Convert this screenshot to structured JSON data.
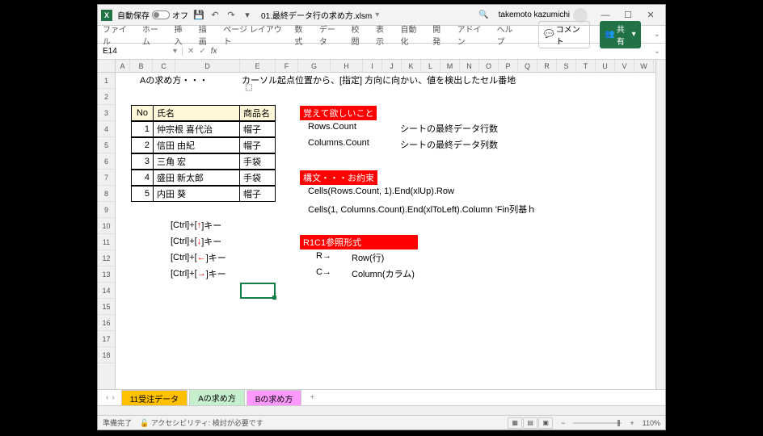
{
  "titlebar": {
    "autosave_label": "自動保存",
    "autosave_state": "オフ",
    "filename": "01.最終データ行の求め方.xlsm",
    "username": "takemoto kazumichi"
  },
  "ribbon": {
    "tabs": [
      "ファイル",
      "ホーム",
      "挿入",
      "描画",
      "ページ レイアウト",
      "数式",
      "データ",
      "校閲",
      "表示",
      "自動化",
      "開発",
      "アドイン",
      "ヘルプ"
    ],
    "comment_btn": "コメント",
    "share_btn": "共有"
  },
  "name_box": "E14",
  "columns": [
    {
      "l": "A",
      "w": 18
    },
    {
      "l": "B",
      "w": 28
    },
    {
      "l": "C",
      "w": 28
    },
    {
      "l": "D",
      "w": 80
    },
    {
      "l": "E",
      "w": 44
    },
    {
      "l": "F",
      "w": 28
    },
    {
      "l": "G",
      "w": 40
    },
    {
      "l": "H",
      "w": 40
    },
    {
      "l": "I",
      "w": 24
    },
    {
      "l": "J",
      "w": 24
    },
    {
      "l": "K",
      "w": 24
    },
    {
      "l": "L",
      "w": 24
    },
    {
      "l": "M",
      "w": 24
    },
    {
      "l": "N",
      "w": 24
    },
    {
      "l": "O",
      "w": 24
    },
    {
      "l": "P",
      "w": 24
    },
    {
      "l": "Q",
      "w": 24
    },
    {
      "l": "R",
      "w": 24
    },
    {
      "l": "S",
      "w": 24
    },
    {
      "l": "T",
      "w": 24
    },
    {
      "l": "U",
      "w": 24
    },
    {
      "l": "V",
      "w": 24
    },
    {
      "l": "W",
      "w": 24
    }
  ],
  "row_count": 18,
  "cells": {
    "heading": "Aの求め方・・・",
    "description": "カーソル起点位置から、[指定] 方向に向かい、値を検出したセル番地",
    "table_headers": {
      "no": "No",
      "name": "氏名",
      "item": "商品名"
    },
    "table_rows": [
      {
        "no": "1",
        "name": "仲宗根 喜代治",
        "item": "帽子"
      },
      {
        "no": "2",
        "name": "信田 由紀",
        "item": "帽子"
      },
      {
        "no": "3",
        "name": "三角 宏",
        "item": "手袋"
      },
      {
        "no": "4",
        "name": "盛田 新太郎",
        "item": "手袋"
      },
      {
        "no": "5",
        "name": "内田 葵",
        "item": "帽子"
      }
    ],
    "ctrl_lines": [
      {
        "pre": "[Ctrl]+[",
        "arrow": "↑",
        "post": "]キー"
      },
      {
        "pre": "[Ctrl]+[",
        "arrow": "↓",
        "post": "]キー"
      },
      {
        "pre": "[Ctrl]+[",
        "arrow": "←",
        "post": "]キー"
      },
      {
        "pre": "[Ctrl]+[",
        "arrow": "→",
        "post": "]キー"
      }
    ],
    "red1": "覚えて欲しいこと",
    "rows_count": "Rows.Count",
    "rows_desc": "シートの最終データ行数",
    "cols_count": "Columns.Count",
    "cols_desc": "シートの最終データ列数",
    "red2": "構文・・・お約束",
    "syntax1": "Cells(Rows.Count, 1).End(xlUp).Row",
    "syntax2": "Cells(1, Columns.Count).End(xlToLeft).Column 'Fin列基ｈ",
    "red3": "R1C1参照形式",
    "r_arrow": "R→",
    "r_desc": "Row(行)",
    "c_arrow": "C→",
    "c_desc": "Column(カラム)"
  },
  "sheet_tabs": [
    "11受注データ",
    "Aの求め方",
    "Bの求め方"
  ],
  "statusbar": {
    "ready": "準備完了",
    "accessibility": "アクセシビリティ: 検討が必要です",
    "zoom": "110%"
  },
  "chart_data": null
}
